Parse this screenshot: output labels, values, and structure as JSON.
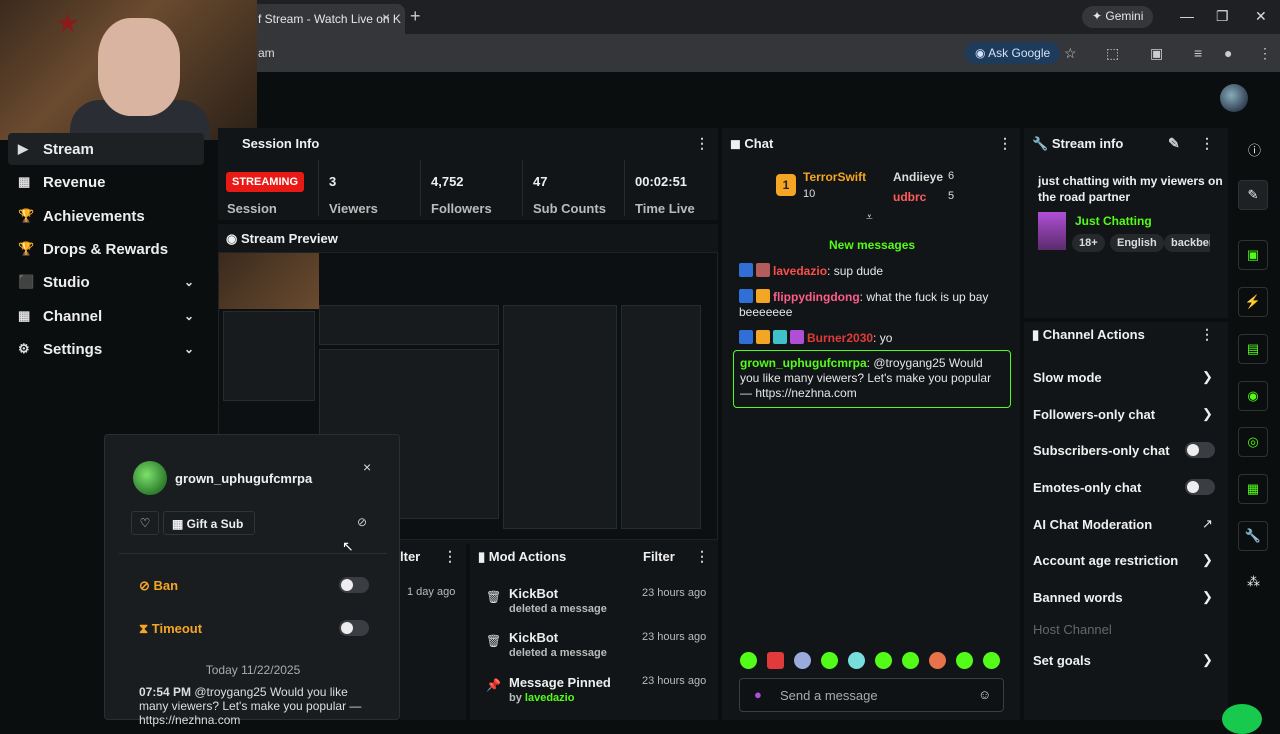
{
  "browser": {
    "tab_title": "f Stream - Watch Live on K",
    "tab_close": "×",
    "new_tab": "+",
    "gemini_label": "Gemini",
    "url": "am",
    "ask_google": "Ask Google"
  },
  "sidebar": {
    "items": [
      {
        "label": "Stream",
        "icon": "▶",
        "active": true
      },
      {
        "label": "Revenue",
        "icon": "▦"
      },
      {
        "label": "Achievements",
        "icon": "🏆"
      },
      {
        "label": "Drops & Rewards",
        "icon": "🏆"
      },
      {
        "label": "Studio",
        "icon": "⬛",
        "chevron": "⌄"
      },
      {
        "label": "Channel",
        "icon": "▦",
        "chevron": "⌄"
      },
      {
        "label": "Settings",
        "icon": "⚙",
        "chevron": "⌄"
      }
    ]
  },
  "session": {
    "title": "Session Info",
    "badge": "STREAMING",
    "session_label": "Session",
    "stats": [
      {
        "value": "3",
        "label": "Viewers"
      },
      {
        "value": "4,752",
        "label": "Followers"
      },
      {
        "value": "47",
        "label": "Sub Counts"
      },
      {
        "value": "00:02:51",
        "label": "Time Live"
      }
    ]
  },
  "preview": {
    "title": "Stream Preview"
  },
  "card": {
    "username": "grown_uphugufcmrpa",
    "close": "×",
    "gift_label": "Gift a Sub",
    "ban_label": "Ban",
    "timeout_label": "Timeout",
    "date": "Today 11/22/2025",
    "msg_time": "07:54 PM",
    "msg_text": "@troygang25 Would you like many viewers? Let's make you popular — https://nezhna.com"
  },
  "filter_panel": {
    "label": "lter",
    "time": "1 day ago"
  },
  "mod_actions": {
    "title": "Mod Actions",
    "filter": "Filter",
    "items": [
      {
        "title": "KickBot",
        "sub": "deleted a message",
        "time": "23 hours ago",
        "icon": "🗑"
      },
      {
        "title": "KickBot",
        "sub": "deleted a message",
        "time": "23 hours ago",
        "icon": "🗑"
      },
      {
        "title": "Message Pinned",
        "sub_prefix": "by",
        "sub_user": "lavedazio",
        "time": "23 hours ago",
        "icon": "📌"
      }
    ]
  },
  "chat": {
    "title": "Chat",
    "top_gifters": [
      {
        "name": "TerrorSwift",
        "count": "10"
      },
      {
        "name": "Andiieye",
        "count": "6"
      },
      {
        "name": "udbrc",
        "count": "5"
      }
    ],
    "new_messages": "New messages",
    "messages": [
      {
        "user": "lavedazio",
        "text": "sup dude",
        "color": "#ff4d4d"
      },
      {
        "user": "flippydingdong",
        "text": "what the fuck is up bay beeeeeee",
        "color": "#ff5c8a"
      },
      {
        "user": "Burner2030",
        "text": "yo",
        "color": "#e03a3a"
      },
      {
        "user": "grown_uphugufcmrpa",
        "text": "@troygang25 Would you like many viewers? Let's make you popular — https://nezhna.com",
        "color": "#53fc18"
      }
    ],
    "send_placeholder": "Send a message"
  },
  "stream_info": {
    "title": "Stream info",
    "stream_title": "just chatting with my viewers on the road partner",
    "category": "Just Chatting",
    "tags": [
      "18+",
      "English",
      "backber"
    ]
  },
  "channel_actions": {
    "title": "Channel Actions",
    "rows": [
      {
        "label": "Slow mode",
        "control": "arrow"
      },
      {
        "label": "Followers-only chat",
        "control": "arrow"
      },
      {
        "label": "Subscribers-only chat",
        "control": "toggle"
      },
      {
        "label": "Emotes-only chat",
        "control": "toggle"
      },
      {
        "label": "AI Chat Moderation",
        "control": "external"
      },
      {
        "label": "Account age restriction",
        "control": "arrow"
      },
      {
        "label": "Banned words",
        "control": "arrow"
      },
      {
        "label": "Host Channel",
        "control": "none",
        "disabled": true
      },
      {
        "label": "Set goals",
        "control": "arrow"
      }
    ]
  },
  "colors": {
    "accent": "#53fc18",
    "streaming": "#e91916",
    "bg": "#0b0e0f",
    "panel": "#121517"
  }
}
